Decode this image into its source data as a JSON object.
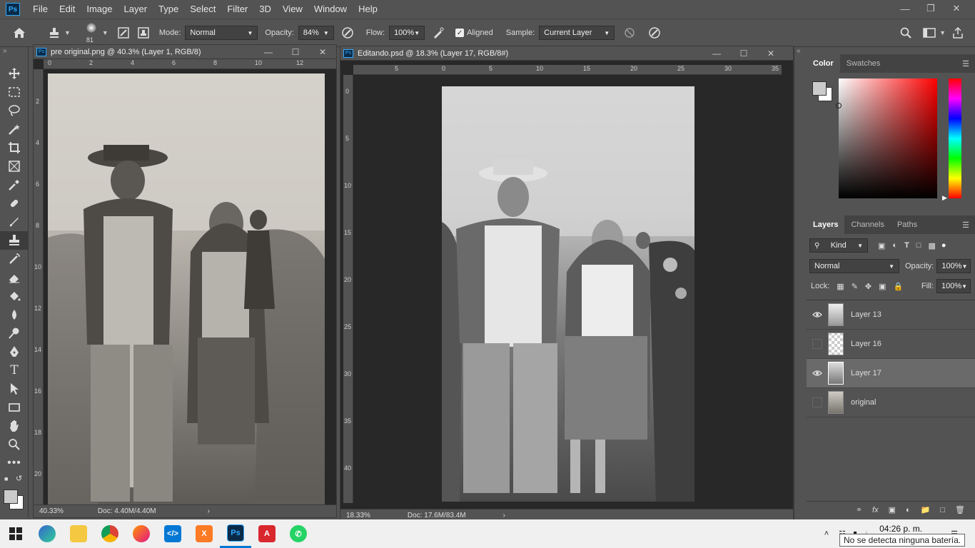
{
  "menu": [
    "File",
    "Edit",
    "Image",
    "Layer",
    "Type",
    "Select",
    "Filter",
    "3D",
    "View",
    "Window",
    "Help"
  ],
  "app_logo": "Ps",
  "options": {
    "brush_size": "81",
    "mode_label": "Mode:",
    "mode_value": "Normal",
    "opacity_label": "Opacity:",
    "opacity_value": "84%",
    "flow_label": "Flow:",
    "flow_value": "100%",
    "aligned_label": "Aligned",
    "sample_label": "Sample:",
    "sample_value": "Current Layer"
  },
  "doc1": {
    "title": "pre original.png @ 40.3% (Layer 1, RGB/8)",
    "zoom": "40.33%",
    "doc": "Doc: 4.40M/4.40M",
    "ruler_h": [
      "0",
      "2",
      "4",
      "6",
      "8",
      "10",
      "12"
    ],
    "ruler_v": [
      "2",
      "4",
      "6",
      "8",
      "10",
      "12",
      "14",
      "16",
      "18",
      "20"
    ]
  },
  "doc2": {
    "title": "Editando.psd @ 18.3% (Layer 17, RGB/8#)",
    "zoom": "18.33%",
    "doc": "Doc: 17.6M/83.4M",
    "ruler_h": [
      "5",
      "0",
      "5",
      "10",
      "15",
      "20",
      "25",
      "30",
      "35"
    ],
    "ruler_v": [
      "0",
      "5",
      "10",
      "15",
      "20",
      "25",
      "30",
      "35",
      "40"
    ]
  },
  "color_panel": {
    "tabs": [
      "Color",
      "Swatches"
    ]
  },
  "layers_panel": {
    "tabs": [
      "Layers",
      "Channels",
      "Paths"
    ],
    "kind_label": "Kind",
    "blend_mode": "Normal",
    "opacity_label": "Opacity:",
    "opacity_value": "100%",
    "lock_label": "Lock:",
    "fill_label": "Fill:",
    "fill_value": "100%",
    "layers": [
      {
        "name": "Layer 13",
        "visible": true,
        "selected": false
      },
      {
        "name": "Layer 16",
        "visible": false,
        "selected": false
      },
      {
        "name": "Layer 17",
        "visible": true,
        "selected": true
      },
      {
        "name": "original",
        "visible": false,
        "selected": false
      }
    ]
  },
  "taskbar": {
    "time": "04:26 p. m.",
    "tooltip": "No se detecta ninguna batería."
  }
}
